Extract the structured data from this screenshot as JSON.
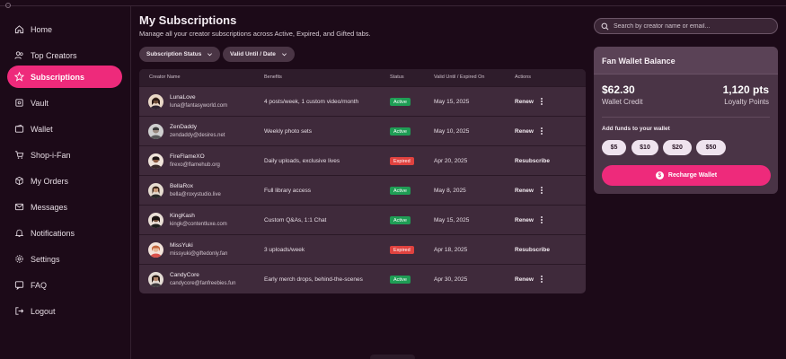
{
  "sidebar": {
    "items": [
      {
        "label": "Home",
        "icon": "home-icon"
      },
      {
        "label": "Top Creators",
        "icon": "users-icon"
      },
      {
        "label": "Subscriptions",
        "icon": "star-icon",
        "active": true
      },
      {
        "label": "Vault",
        "icon": "vault-icon"
      },
      {
        "label": "Wallet",
        "icon": "wallet-icon"
      },
      {
        "label": "Shop-i-Fan",
        "icon": "cart-icon"
      },
      {
        "label": "My Orders",
        "icon": "orders-icon"
      },
      {
        "label": "Messages",
        "icon": "messages-icon"
      },
      {
        "label": "Notifications",
        "icon": "bell-icon"
      },
      {
        "label": "Settings",
        "icon": "gear-icon"
      },
      {
        "label": "FAQ",
        "icon": "faq-icon"
      },
      {
        "label": "Logout",
        "icon": "logout-icon"
      }
    ]
  },
  "header": {
    "title": "My Subscriptions",
    "subtitle": "Manage all your creator subscriptions across Active, Expired, and Gifted tabs."
  },
  "filters": {
    "status": "Subscription Status",
    "date": "Valid Until / Date"
  },
  "table": {
    "columns": [
      "Creator Name",
      "Benefits",
      "Status",
      "Valid Until / Expired On",
      "Actions"
    ],
    "rows": [
      {
        "name": "LunaLove",
        "email": "luna@fantasyworld.com",
        "benefits": "4 posts/week, 1 custom video/month",
        "status": "Active",
        "date": "May 15, 2025",
        "action": "Renew"
      },
      {
        "name": "ZenDaddy",
        "email": "zendaddy@desires.net",
        "benefits": "Weekly photo sets",
        "status": "Active",
        "date": "May 10, 2025",
        "action": "Renew"
      },
      {
        "name": "FireFlameXO",
        "email": "firexo@flamehub.org",
        "benefits": "Daily uploads, exclusive lives",
        "status": "Expired",
        "date": "Apr 20, 2025",
        "action": "Resubscribe"
      },
      {
        "name": "BellaRox",
        "email": "bella@roxystudio.live",
        "benefits": "Full library access",
        "status": "Active",
        "date": "May 8, 2025",
        "action": "Renew"
      },
      {
        "name": "KingKash",
        "email": "kingk@contentluxe.com",
        "benefits": "Custom Q&As, 1:1 Chat",
        "status": "Active",
        "date": "May 15, 2025",
        "action": "Renew"
      },
      {
        "name": "MissYuki",
        "email": "missyuki@giftedonly.fan",
        "benefits": "3 uploads/week",
        "status": "Expired",
        "date": "Apr 18, 2025",
        "action": "Resubscribe"
      },
      {
        "name": "CandyCore",
        "email": "candycore@fanfreebies.fun",
        "benefits": "Early merch drops, behind-the-scenes",
        "status": "Active",
        "date": "Apr 30, 2025",
        "action": "Renew"
      }
    ]
  },
  "search": {
    "placeholder": "Search by creator name or email..."
  },
  "wallet": {
    "title": "Fan Wallet Balance",
    "credit_value": "$62.30",
    "credit_label": "Wallet Credit",
    "points_value": "1,120 pts",
    "points_label": "Loyalty Points",
    "add_label": "Add funds to your wallet",
    "amounts": [
      "$5",
      "$10",
      "$20",
      "$50"
    ],
    "recharge_label": "Recharge Wallet",
    "recharge_icon": "$"
  },
  "colors": {
    "accent": "#ee2a7b",
    "active": "#1f9d55",
    "expired": "#e0423f",
    "background": "#1c0a18"
  }
}
